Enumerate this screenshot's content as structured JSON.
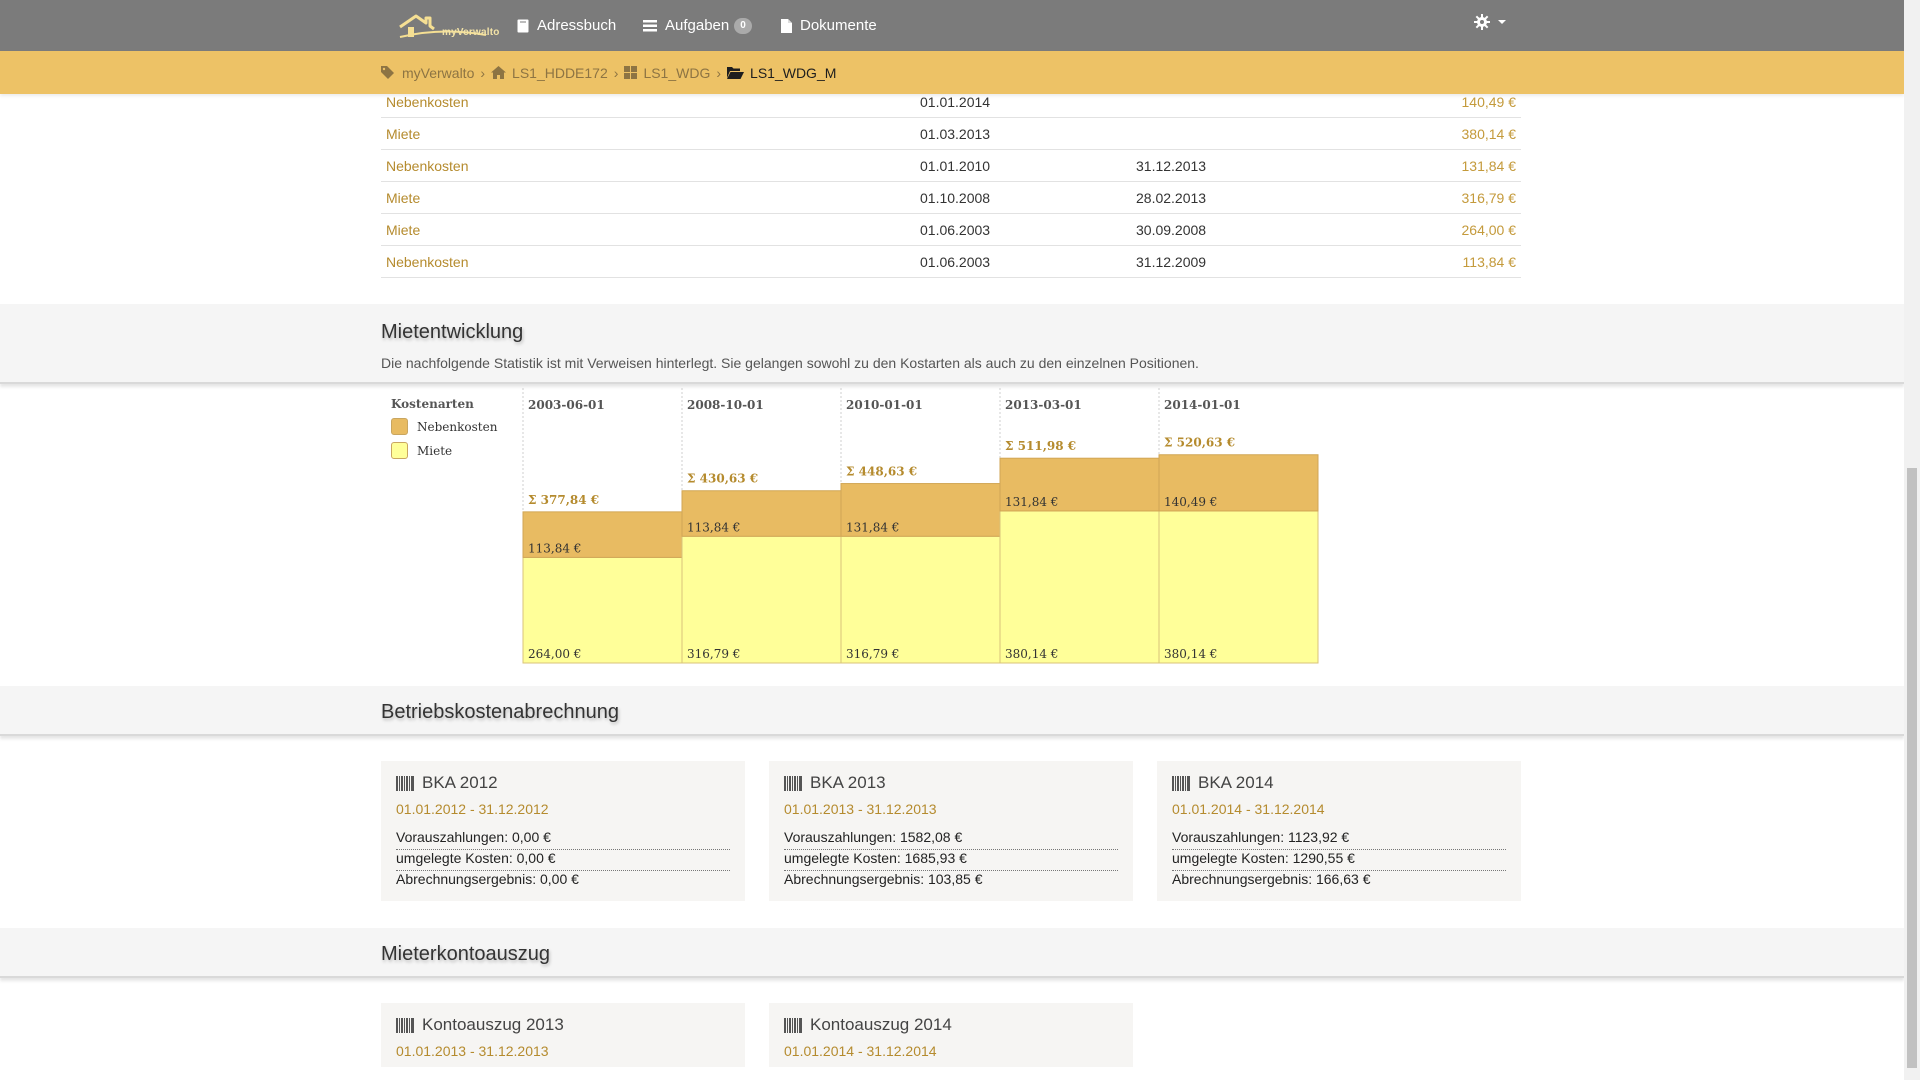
{
  "nav": {
    "logo_text": "myVerwalto",
    "addressbook_label": "Adressbuch",
    "tasks_label": "Aufgaben",
    "tasks_count": "0",
    "documents_label": "Dokumente",
    "settings_icon": "gear-icon"
  },
  "breadcrumb": {
    "items": [
      {
        "label": "myVerwalto",
        "icon": "tags-icon"
      },
      {
        "label": "LS1_HDDE172",
        "icon": "home-icon"
      },
      {
        "label": "LS1_WDG",
        "icon": "grid-icon"
      },
      {
        "label": "LS1_WDG_M",
        "icon": "folder-open-icon"
      }
    ],
    "separator": "›"
  },
  "positions": [
    {
      "type": "Nebenkosten",
      "from": "01.01.2014",
      "to": "",
      "amount": "140,49 €"
    },
    {
      "type": "Miete",
      "from": "01.03.2013",
      "to": "",
      "amount": "380,14 €"
    },
    {
      "type": "Nebenkosten",
      "from": "01.01.2010",
      "to": "31.12.2013",
      "amount": "131,84 €"
    },
    {
      "type": "Miete",
      "from": "01.10.2008",
      "to": "28.02.2013",
      "amount": "316,79 €"
    },
    {
      "type": "Miete",
      "from": "01.06.2003",
      "to": "30.09.2008",
      "amount": "264,00 €"
    },
    {
      "type": "Nebenkosten",
      "from": "01.06.2003",
      "to": "31.12.2009",
      "amount": "113,84 €"
    }
  ],
  "rent_section": {
    "title": "Mietentwicklung",
    "description": "Die nachfolgende Statistik ist mit Verweisen hinterlegt. Sie gelangen sowohl zu den Kostarten als auch zu den einzelnen Positionen."
  },
  "chart_data": {
    "type": "bar",
    "stacked": true,
    "legend_title": "Kostenarten",
    "legend_position": "left",
    "categories": [
      "2003-06-01",
      "2008-10-01",
      "2010-01-01",
      "2013-03-01",
      "2014-01-01"
    ],
    "series": [
      {
        "name": "Nebenkosten",
        "color": "#e8bb62",
        "values": [
          113.84,
          113.84,
          131.84,
          131.84,
          140.49
        ],
        "labels": [
          "113,84 €",
          "113,84 €",
          "131,84 €",
          "131,84 €",
          "140,49 €"
        ]
      },
      {
        "name": "Miete",
        "color": "#ffff99",
        "values": [
          264.0,
          316.79,
          316.79,
          380.14,
          380.14
        ],
        "labels": [
          "264,00 €",
          "316,79 €",
          "316,79 €",
          "380,14 €",
          "380,14 €"
        ]
      }
    ],
    "totals": [
      "Σ 377,84 €",
      "Σ 430,63 €",
      "Σ 448,63 €",
      "Σ 511,98 €",
      "Σ 520,63 €"
    ],
    "total_values": [
      377.84,
      430.63,
      448.63,
      511.98,
      520.63
    ],
    "bar_count": 5,
    "ylim": [
      0,
      625
    ],
    "grid": false
  },
  "bka_section": {
    "title": "Betriebskostenabrechnung",
    "cards": [
      {
        "title": "BKA 2012",
        "period": "01.01.2012 - 31.12.2012",
        "prepayments": "Vorauszahlungen: 0,00 €",
        "allocated": "umgelegte Kosten: 0,00 €",
        "result": "Abrechnungsergebnis: 0,00 €"
      },
      {
        "title": "BKA 2013",
        "period": "01.01.2013 - 31.12.2013",
        "prepayments": "Vorauszahlungen: 1582,08 €",
        "allocated": "umgelegte Kosten: 1685,93 €",
        "result": "Abrechnungsergebnis: 103,85 €"
      },
      {
        "title": "BKA 2014",
        "period": "01.01.2014 - 31.12.2014",
        "prepayments": "Vorauszahlungen: 1123,92 €",
        "allocated": "umgelegte Kosten: 1290,55 €",
        "result": "Abrechnungsergebnis: 166,63 €"
      }
    ]
  },
  "account_section": {
    "title": "Mieterkontoauszug",
    "cards": [
      {
        "title": "Kontoauszug 2013",
        "period": "01.01.2013 - 31.12.2013"
      },
      {
        "title": "Kontoauszug 2014",
        "period": "01.01.2014 - 31.12.2014"
      }
    ]
  },
  "colors": {
    "navbar": "#7b7b7b",
    "breadcrumb_bar": "#edc266",
    "link": "#b58b2e",
    "nebenkosten": "#e8bb62",
    "miete": "#ffff99"
  }
}
